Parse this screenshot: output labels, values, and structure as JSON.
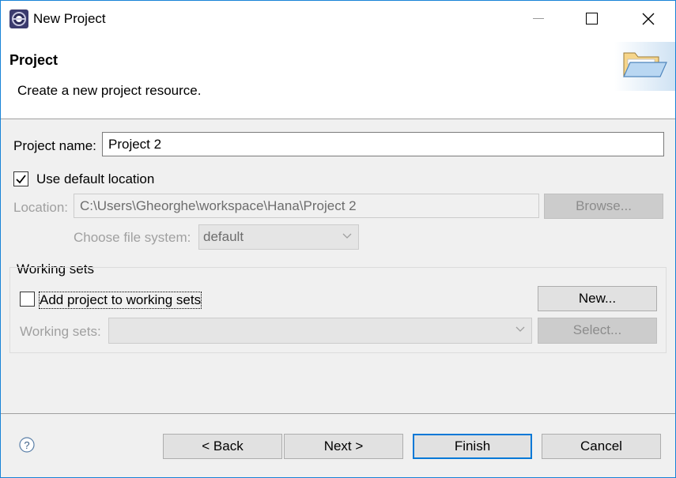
{
  "window": {
    "title": "New Project",
    "app_icon": "eclipse-icon",
    "minimize_icon": "minimize-icon",
    "maximize_icon": "maximize-icon",
    "close_icon": "close-icon"
  },
  "banner": {
    "title": "Project",
    "description": "Create a new project resource.",
    "image_icon": "open-folder-icon"
  },
  "form": {
    "project_name_label": "Project name:",
    "project_name_value": "Project 2",
    "use_default_location_label": "Use default location",
    "use_default_location_checked": true,
    "location_label": "Location:",
    "location_value": "C:\\Users\\Gheorghe\\workspace\\Hana\\Project 2",
    "browse_label": "Browse...",
    "file_system_label": "Choose file system:",
    "file_system_value": "default"
  },
  "working_sets": {
    "group_label": "Working sets",
    "add_label": "Add project to working sets",
    "add_checked": false,
    "new_label": "New...",
    "sets_label": "Working sets:",
    "sets_value": "",
    "select_label": "Select..."
  },
  "footer": {
    "help_icon": "help-icon",
    "back_label": "< Back",
    "next_label": "Next >",
    "finish_label": "Finish",
    "cancel_label": "Cancel"
  },
  "colors": {
    "window_border": "#1883d7",
    "default_button_border": "#0078d7",
    "disabled_text": "#a0a0a0"
  }
}
